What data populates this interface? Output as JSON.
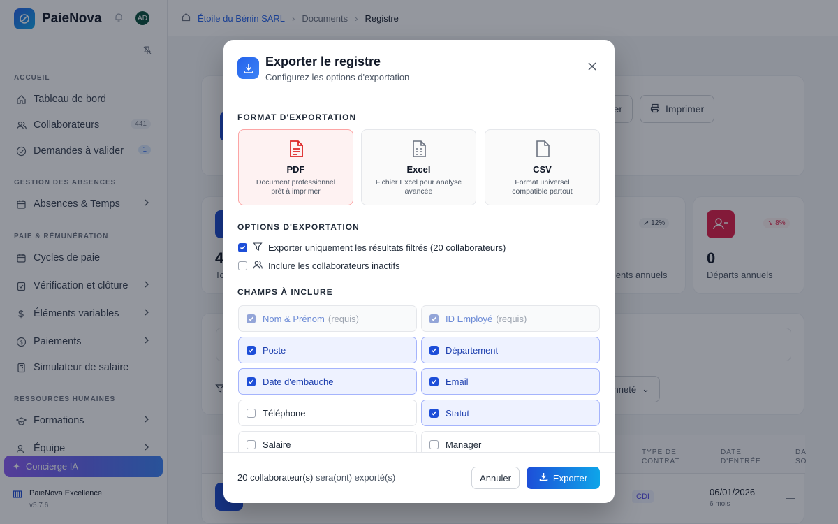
{
  "brand": {
    "name": "PaieNova",
    "avatar": "AD"
  },
  "sidebar": {
    "sections": [
      "ACCUEIL",
      "GESTION DES ABSENCES",
      "PAIE & RÉMUNÉRATION",
      "RESSOURCES HUMAINES"
    ],
    "items": [
      {
        "label": "Tableau de bord",
        "icon": "home-icon"
      },
      {
        "label": "Collaborateurs",
        "icon": "users-icon",
        "badge": "441"
      },
      {
        "label": "Demandes à valider",
        "icon": "check-circle-icon",
        "badge": "1"
      },
      {
        "label": "Absences & Temps",
        "icon": "calendar-icon"
      },
      {
        "label": "Cycles de paie",
        "icon": "calendar-icon"
      },
      {
        "label": "Vérification et clôture",
        "icon": "clipboard-check-icon"
      },
      {
        "label": "Éléments variables",
        "icon": "dollar-icon"
      },
      {
        "label": "Paiements",
        "icon": "coin-icon"
      },
      {
        "label": "Simulateur de salaire",
        "icon": "calculator-icon"
      },
      {
        "label": "Formations",
        "icon": "graduation-cap-icon"
      },
      {
        "label": "Équipe",
        "icon": "users-icon"
      }
    ],
    "concierge": "Concierge IA",
    "footer": {
      "name": "PaieNova Excellence",
      "version": "v5.7.6"
    }
  },
  "breadcrumb": [
    "Étoile du Bénin SARL",
    "Documents",
    "Registre"
  ],
  "background": {
    "buttons": [
      "er",
      "Imprimer"
    ],
    "kpis": [
      {
        "value": "4",
        "label": "To"
      },
      {
        "trend": "↗ 12%",
        "label": "ments annuels"
      },
      {
        "value": "0",
        "label": "Départs annuels",
        "trend": "↘ 8%"
      }
    ],
    "filter_label": "enneté",
    "table_headers": [
      "TYPE DE CONTRAT",
      "DATE D'ENTRÉE",
      "DA SO"
    ],
    "row": {
      "contract": "CDI",
      "date": "06/01/2026",
      "duration": "6 mois",
      "dash": "—"
    }
  },
  "modal": {
    "title": "Exporter le registre",
    "subtitle": "Configurez les options d'exportation",
    "format_label": "FORMAT D'EXPORTATION",
    "formats": [
      {
        "name": "PDF",
        "desc": "Document professionnel prêt à imprimer",
        "selected": true
      },
      {
        "name": "Excel",
        "desc": "Fichier Excel pour analyse avancée",
        "selected": false
      },
      {
        "name": "CSV",
        "desc": "Format universel compatible partout",
        "selected": false
      }
    ],
    "options_label": "OPTIONS D'EXPORTATION",
    "options": [
      {
        "label": "Exporter uniquement les résultats filtrés (20 collaborateurs)",
        "checked": true
      },
      {
        "label": "Inclure les collaborateurs inactifs",
        "checked": false
      }
    ],
    "fields_label": "CHAMPS À INCLURE",
    "required_suffix": "(requis)",
    "fields": [
      {
        "label": "Nom & Prénom",
        "state": "required"
      },
      {
        "label": "ID Employé",
        "state": "required"
      },
      {
        "label": "Poste",
        "state": "on"
      },
      {
        "label": "Département",
        "state": "on"
      },
      {
        "label": "Date d'embauche",
        "state": "on"
      },
      {
        "label": "Email",
        "state": "on"
      },
      {
        "label": "Téléphone",
        "state": "off"
      },
      {
        "label": "Statut",
        "state": "on"
      },
      {
        "label": "Salaire",
        "state": "off"
      },
      {
        "label": "Manager",
        "state": "off"
      }
    ],
    "footer_count": "20 collaborateur(s)",
    "footer_suffix": "sera(ont) exporté(s)",
    "cancel": "Annuler",
    "export": "Exporter"
  },
  "colors": {
    "accent": "#1d4ed8",
    "pdf": "#dc2626",
    "danger": "#e11d48"
  }
}
